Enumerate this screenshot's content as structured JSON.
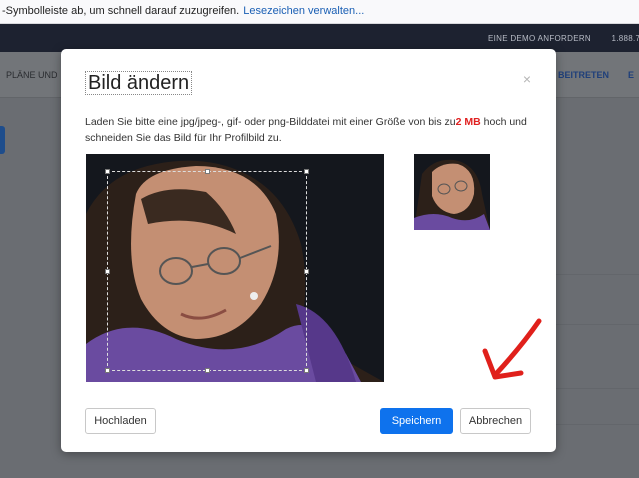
{
  "browser_notice": {
    "text": "-Symbolleiste ab, um schnell darauf zuzugreifen.",
    "link": "Lesezeichen verwalten..."
  },
  "site_header": {
    "demo_link": "EINE DEMO ANFORDERN",
    "phone": "1.888.79"
  },
  "page_nav": {
    "plans": "PLÄNE UND",
    "edit": "BEITRETEN",
    "extra": "E"
  },
  "modal": {
    "title": "Bild ändern",
    "close_icon": "×",
    "instructions_before": "Laden Sie bitte eine jpg/jpeg-, gif- oder png-Bilddatei mit einer Größe von bis zu",
    "size_limit": "2 MB",
    "instructions_after": " hoch und schneiden Sie das Bild für Ihr Profilbild zu.",
    "buttons": {
      "upload": "Hochladen",
      "save": "Speichern",
      "cancel": "Abbrechen"
    }
  },
  "colors": {
    "primary_button": "#0e72ed",
    "size_limit_text": "#e02020",
    "annotation_arrow": "#e0201b"
  }
}
